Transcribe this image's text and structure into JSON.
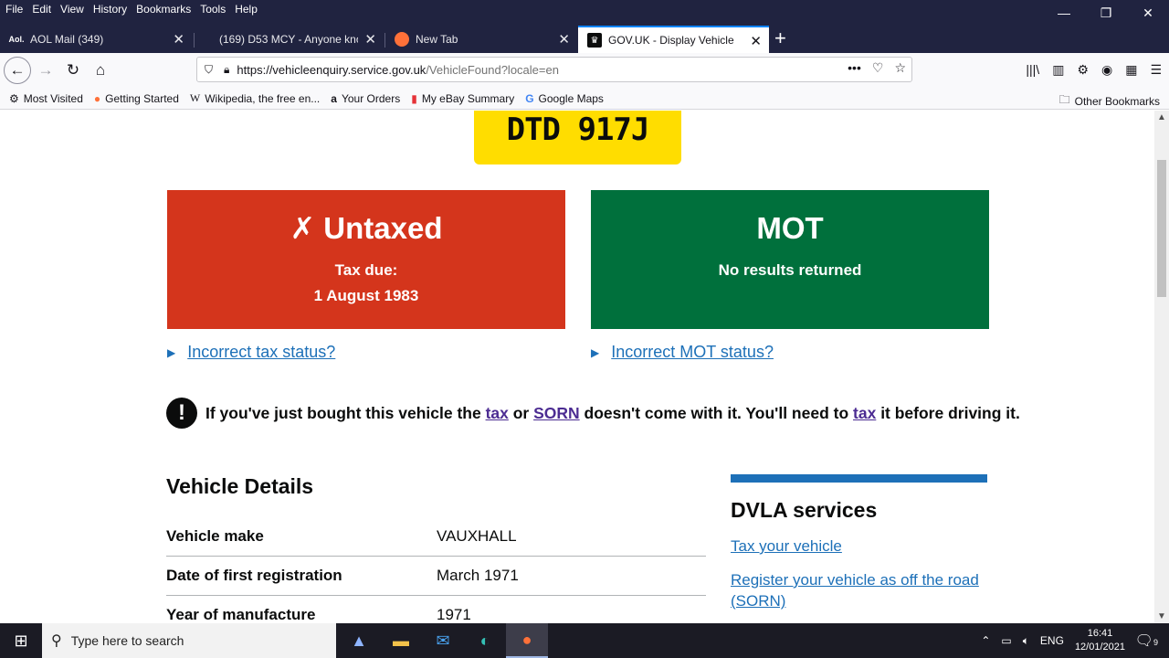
{
  "menu": [
    "File",
    "Edit",
    "View",
    "History",
    "Bookmarks",
    "Tools",
    "Help"
  ],
  "tabs": [
    {
      "title": "AOL Mail (349)",
      "icon": "aol-icon"
    },
    {
      "title": "(169) D53 MCY - Anyone know",
      "icon": "none"
    },
    {
      "title": "New Tab",
      "icon": "firefox-icon"
    },
    {
      "title": "GOV.UK - Display Vehicle",
      "icon": "govuk-crown-icon"
    }
  ],
  "url": {
    "host": "https://vehicleenquiry.service.gov.uk",
    "rest": "/VehicleFound?locale=en"
  },
  "bookmarks": [
    "Most Visited",
    "Getting Started",
    "Wikipedia, the free en...",
    "Your Orders",
    "My eBay Summary",
    "Google Maps"
  ],
  "bookmarks_other": "Other Bookmarks",
  "page": {
    "plate": "DTD 917J",
    "tax": {
      "heading": "✗ Untaxed",
      "label": "Tax due:",
      "date": "1 August 1983",
      "color": "#d4351c"
    },
    "mot": {
      "heading": "MOT",
      "label": "No results returned",
      "color": "#00703c"
    },
    "tax_link": "Incorrect tax status?",
    "mot_link": "Incorrect MOT status?",
    "warning": {
      "p1": "If you've just bought this vehicle the ",
      "link1": "tax",
      "p2": " or ",
      "link2": "SORN",
      "p3": " doesn't come with it. You'll need to ",
      "link3": "tax",
      "p4": " it before driving it."
    },
    "details_title": "Vehicle Details",
    "details": [
      {
        "key": "Vehicle make",
        "value": "VAUXHALL"
      },
      {
        "key": "Date of first registration",
        "value": "March 1971"
      },
      {
        "key": "Year of manufacture",
        "value": "1971"
      }
    ],
    "services_title": "DVLA services",
    "services": [
      "Tax your vehicle",
      "Register your vehicle as off the road (SORN)"
    ]
  },
  "taskbar": {
    "search_placeholder": "Type here to search",
    "lang": "ENG",
    "time": "16:41",
    "date": "12/01/2021",
    "notifications": "9"
  }
}
